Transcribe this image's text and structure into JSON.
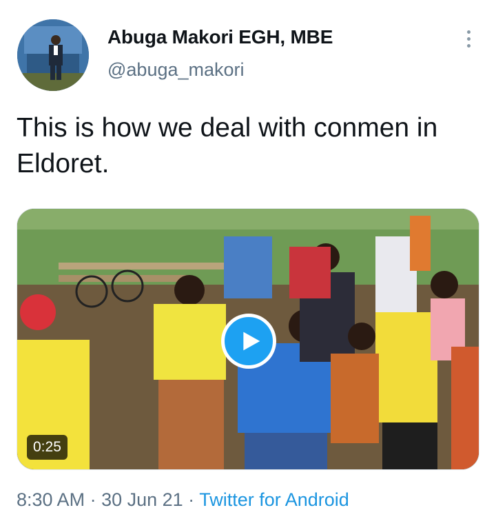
{
  "author": {
    "display_name": "Abuga Makori EGH, MBE",
    "handle": "@abuga_makori",
    "avatar_icon": "profile-photo"
  },
  "tweet": {
    "text": "This is how we deal with conmen in Eldoret."
  },
  "media": {
    "type": "video",
    "duration": "0:25",
    "play_icon": "play-icon"
  },
  "meta": {
    "time": "8:30 AM",
    "separator1": " · ",
    "date": "30 Jun 21",
    "separator2": " · ",
    "source": "Twitter for Android"
  },
  "colors": {
    "accent": "#1da1f2",
    "link": "#1b95e0",
    "secondary_text": "#5b7083",
    "primary_text": "#0f1419"
  }
}
